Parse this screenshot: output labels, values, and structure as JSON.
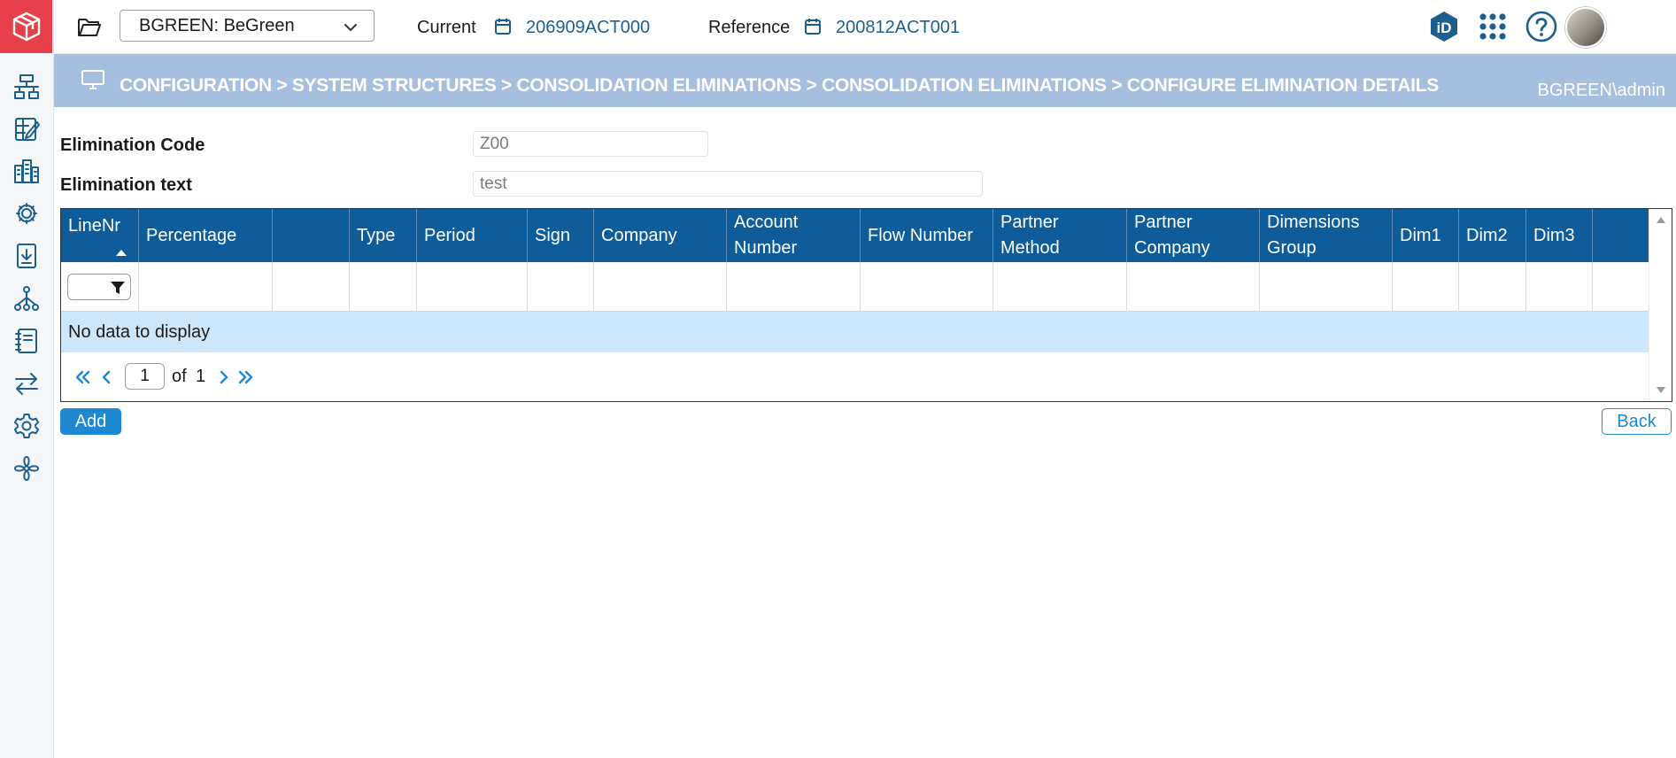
{
  "app": {
    "logo_icon": "cube-logo-icon",
    "brand_color": "#e8404a",
    "primary_color": "#0e5c99",
    "accent_color": "#1e88d2"
  },
  "sidebar": {
    "items": [
      {
        "icon": "structure-flow-icon"
      },
      {
        "icon": "sheet-edit-icon"
      },
      {
        "icon": "buildings-icon"
      },
      {
        "icon": "gear-cluster-icon"
      },
      {
        "icon": "download-document-icon"
      },
      {
        "icon": "hierarchy-icon"
      },
      {
        "icon": "notebook-icon"
      },
      {
        "icon": "transfer-arrows-icon"
      },
      {
        "icon": "settings-icon"
      },
      {
        "icon": "fan-icon"
      }
    ]
  },
  "topbar": {
    "company_select": "BGREEN: BeGreen",
    "current_label": "Current",
    "current_value": "206909ACT000",
    "reference_label": "Reference",
    "reference_value": "200812ACT001"
  },
  "banner": {
    "breadcrumb": "CONFIGURATION > SYSTEM STRUCTURES > CONSOLIDATION ELIMINATIONS > CONSOLIDATION ELIMINATIONS > CONFIGURE ELIMINATION DETAILS",
    "user": "BGREEN\\admin"
  },
  "form": {
    "code_label": "Elimination Code",
    "code_value": "Z00",
    "text_label": "Elimination text",
    "text_value": "test"
  },
  "grid": {
    "columns": [
      {
        "line1": "LineNr",
        "line2": ""
      },
      {
        "line1": "Percentage",
        "line2": ""
      },
      {
        "line1": "",
        "line2": ""
      },
      {
        "line1": "Type",
        "line2": ""
      },
      {
        "line1": "Period",
        "line2": ""
      },
      {
        "line1": "Sign",
        "line2": ""
      },
      {
        "line1": "Company",
        "line2": ""
      },
      {
        "line1": "Account",
        "line2": "Number"
      },
      {
        "line1": "Flow Number",
        "line2": ""
      },
      {
        "line1": "Partner",
        "line2": "Method"
      },
      {
        "line1": "Partner",
        "line2": "Company"
      },
      {
        "line1": "Dimensions",
        "line2": "Group"
      },
      {
        "line1": "Dim1",
        "line2": ""
      },
      {
        "line1": "Dim2",
        "line2": ""
      },
      {
        "line1": "Dim3",
        "line2": ""
      },
      {
        "line1": "",
        "line2": ""
      }
    ],
    "empty_text": "No data to display",
    "pager": {
      "page": "1",
      "of_label": "of",
      "total_pages": "1"
    }
  },
  "actions": {
    "add_label": "Add",
    "back_label": "Back"
  }
}
